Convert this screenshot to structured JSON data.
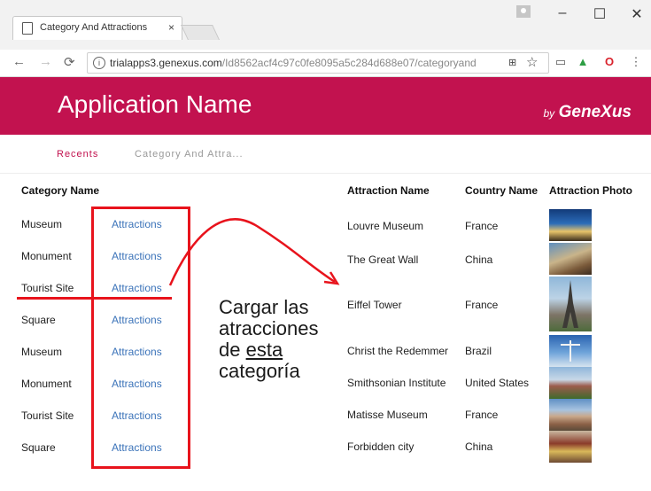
{
  "browser": {
    "tab_title": "Category And Attractions",
    "tab_close": "×",
    "url_host": "trialapps3.genexus.com",
    "url_path": "/Id8562acf4c97c0fe8095a5c284d688e07/categoryand",
    "window_controls": [
      "–",
      "☐",
      "✕"
    ],
    "icons": [
      "page-icon",
      "back-icon",
      "forward-icon",
      "reload-icon",
      "info-icon",
      "translate-icon",
      "star-icon",
      "cast-icon",
      "new-extension-icon",
      "opera-icon",
      "menu-icon",
      "profile-icon"
    ]
  },
  "app": {
    "title": "Application Name",
    "by": "by",
    "brand": "GeneXus",
    "brand_color": "#c2124f"
  },
  "breadcrumb": {
    "recents": "Recents",
    "current": "Category And Attra..."
  },
  "categories": {
    "header": "Category Name",
    "rows": [
      {
        "name": "Museum",
        "link": "Attractions"
      },
      {
        "name": "Monument",
        "link": "Attractions"
      },
      {
        "name": "Tourist Site",
        "link": "Attractions"
      },
      {
        "name": "Square",
        "link": "Attractions"
      },
      {
        "name": "Museum",
        "link": "Attractions"
      },
      {
        "name": "Monument",
        "link": "Attractions"
      },
      {
        "name": "Tourist Site",
        "link": "Attractions"
      },
      {
        "name": "Square",
        "link": "Attractions"
      }
    ]
  },
  "attractions": {
    "headers": [
      "Attraction Name",
      "Country Name",
      "Attraction Photo"
    ],
    "rows": [
      {
        "name": "Louvre Museum",
        "country": "France"
      },
      {
        "name": "The Great Wall",
        "country": "China"
      },
      {
        "name": "Eiffel Tower",
        "country": "France"
      },
      {
        "name": "Christ the Redemmer",
        "country": "Brazil"
      },
      {
        "name": "Smithsonian Institute",
        "country": "United States"
      },
      {
        "name": "Matisse Museum",
        "country": "France"
      },
      {
        "name": "Forbidden city",
        "country": "China"
      }
    ]
  },
  "annotation": {
    "line1": "Cargar las",
    "line2": "atracciones",
    "line3_prefix": "de ",
    "line3_underlined": "esta",
    "line4": "categoría",
    "color": "#e8131c"
  }
}
